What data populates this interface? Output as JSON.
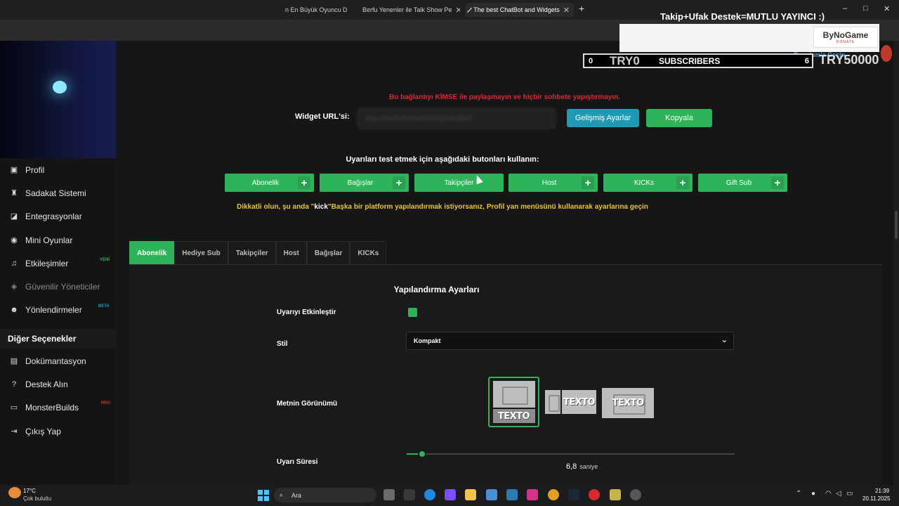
{
  "browser": {
    "tabs": [
      {
        "label": "n En Büyük Oyuncu D",
        "active": false
      },
      {
        "label": "Berfu Yenenler ile Talk Show Pe",
        "active": false
      },
      {
        "label": "The best ChatBot and Widgets",
        "active": true
      }
    ],
    "new_tab": "+",
    "window_controls": {
      "minimize": "–",
      "maximize": "□",
      "close": "✕"
    }
  },
  "overlay": {
    "title": "Takip+Ufak Destek=MUTLU YAYINCI :)",
    "bynogame": {
      "name": "ByNoGame",
      "tag": "DONATE"
    },
    "premium": "Premium'a Geçin",
    "subs": {
      "count_left": "0",
      "amount_left": "TRY0",
      "label": "SUBSCRIBERS",
      "count_right": "6",
      "goal": "TRY50000"
    }
  },
  "sidebar": {
    "items": [
      {
        "label": "Profil",
        "icon": "user-card-icon"
      },
      {
        "label": "Sadakat Sistemi",
        "icon": "trophy-icon"
      },
      {
        "label": "Entegrasyonlar",
        "icon": "integration-icon"
      },
      {
        "label": "Mini Oyunlar",
        "icon": "gamepad-icon"
      },
      {
        "label": "Etkileşimler",
        "icon": "music-note-icon",
        "badge": "YENİ"
      },
      {
        "label": "Güvenilir Yöneticiler",
        "icon": "shield-icon",
        "dim": true
      },
      {
        "label": "Yönlendirmeler",
        "icon": "users-icon",
        "badge": "BETA"
      }
    ],
    "section": "Diğer Seçenekler",
    "section_items": [
      {
        "label": "Dokümantasyon",
        "icon": "docs-icon"
      },
      {
        "label": "Destek Alın",
        "icon": "help-icon"
      },
      {
        "label": "MonsterBuilds",
        "icon": "laptop-icon",
        "badge": "PRO"
      },
      {
        "label": "Çıkış Yap",
        "icon": "logout-icon"
      }
    ]
  },
  "main": {
    "warning": "Bu bağlantıyı KİMSE ile paylaşmayın ve hiçbir sohbete yapıştırmayın.",
    "url_label": "Widget URL'si:",
    "url_value": "https://botrix.live/alert/bdr/q9vfbe3fkp3",
    "advanced_btn": "Gelişmiş Ayarlar",
    "copy_btn": "Kopyala",
    "test_label": "Uyarıları test etmek için aşağıdaki butonları kullanın:",
    "test_buttons": [
      "Abonelik",
      "Bağışlar",
      "Takipçiler",
      "Host",
      "KICKs",
      "Gift Sub"
    ],
    "kick_note_pre": "Dikkatli olun, şu anda \"",
    "kick_note_platform": "kick",
    "kick_note_post": "\"Başka bir platform yapılandırmak istiyorsanız, Profil yan menüsünü kullanarak ayarlarına geçin",
    "tabs": [
      "Abonelik",
      "Hediye Sub",
      "Takipçiler",
      "Host",
      "Bağışlar",
      "KICKs"
    ],
    "active_tab": 0,
    "panel": {
      "title": "Yapılandırma Ayarları",
      "enable_label": "Uyarıyı Etkinleştir",
      "enable_value": true,
      "style_label": "Stil",
      "style_value": "Kompakt",
      "layout_label": "Metnin Görünümü",
      "layout_text": "TEXTO",
      "duration_label": "Uyarı Süresi",
      "duration_value": "6,8",
      "duration_unit": "saniye",
      "duration_fraction": 0.05
    }
  },
  "taskbar": {
    "weather_temp": "17°C",
    "weather_desc": "Çok bulutlu",
    "search": "Ara",
    "time": "21:39",
    "date": "20.11.2025"
  },
  "colors": {
    "accent": "#2fb35a",
    "info": "#1e9ab5",
    "danger": "#d52a3a",
    "warning": "#e7c43a"
  }
}
